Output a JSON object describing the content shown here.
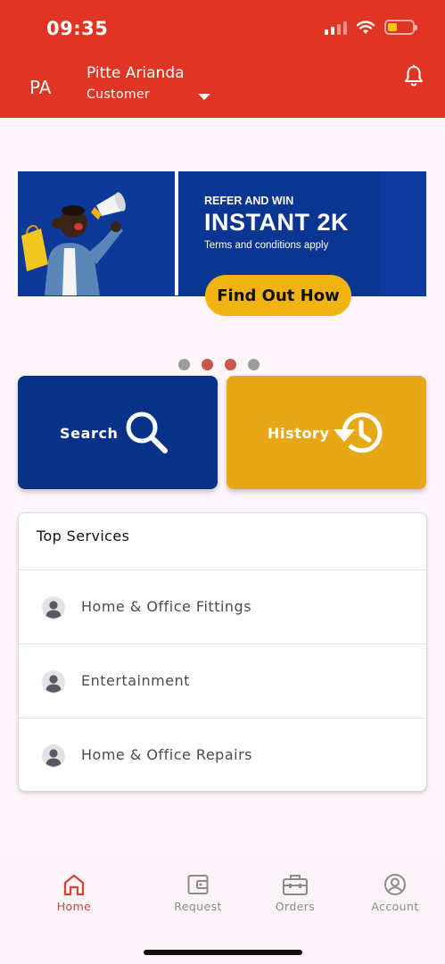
{
  "status_bar": {
    "time": "09:35"
  },
  "header": {
    "initials": "PA",
    "user_name": "Pitte Arianda",
    "user_role": "Customer",
    "icons": {
      "role_dropdown": "caret-down-icon",
      "notifications": "bell-icon"
    }
  },
  "banner": {
    "eyebrow": "REFER AND WIN",
    "headline": "INSTANT 2K",
    "subtext": "Terms and conditions apply",
    "cta_label": "Find Out How",
    "colors": {
      "background": "#0b3592",
      "cta": "#f0b311"
    },
    "carousel": {
      "page_count": 4,
      "highlighted": [
        1,
        2
      ]
    }
  },
  "quick_actions": [
    {
      "label": "Search",
      "icon": "search-icon",
      "color": "#083288"
    },
    {
      "label": "History",
      "icon": "history-icon",
      "color": "#e7a818"
    }
  ],
  "top_services": {
    "title": "Top Services",
    "items": [
      {
        "label": "Home & Office Fittings",
        "icon": "person-icon"
      },
      {
        "label": "Entertainment",
        "icon": "person-icon"
      },
      {
        "label": "Home & Office Repairs",
        "icon": "person-icon"
      }
    ]
  },
  "bottom_nav": {
    "items": [
      {
        "label": "Home",
        "icon": "home-icon",
        "active": true
      },
      {
        "label": "Request",
        "icon": "wallet-icon",
        "active": false
      },
      {
        "label": "Orders",
        "icon": "briefcase-icon",
        "active": false
      },
      {
        "label": "Account",
        "icon": "account-icon",
        "active": false
      }
    ]
  },
  "colors": {
    "accent": "#e03524",
    "active_nav": "#d8432f"
  }
}
